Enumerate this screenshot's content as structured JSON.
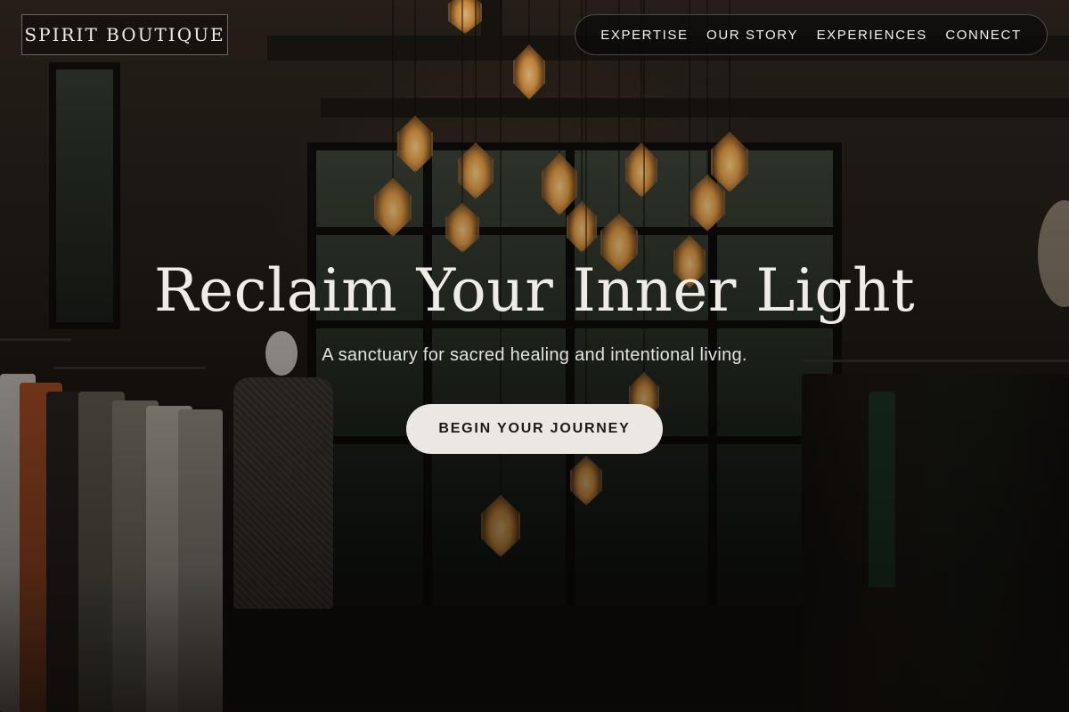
{
  "brand": {
    "name": "SPIRIT BOUTIQUE"
  },
  "nav": {
    "items": [
      {
        "label": "EXPERTISE"
      },
      {
        "label": "OUR STORY"
      },
      {
        "label": "EXPERIENCES"
      },
      {
        "label": "CONNECT"
      }
    ]
  },
  "hero": {
    "title": "Reclaim Your Inner Light",
    "subtitle": "A sanctuary for sacred healing and intentional living.",
    "cta_label": "BEGIN YOUR JOURNEY",
    "background_image": "boutique-interior-with-pendant-lamps"
  },
  "colors": {
    "accent_warm": "#e79e44",
    "cta_background": "#ebe7e3",
    "nav_background": "#0a0a0a"
  }
}
